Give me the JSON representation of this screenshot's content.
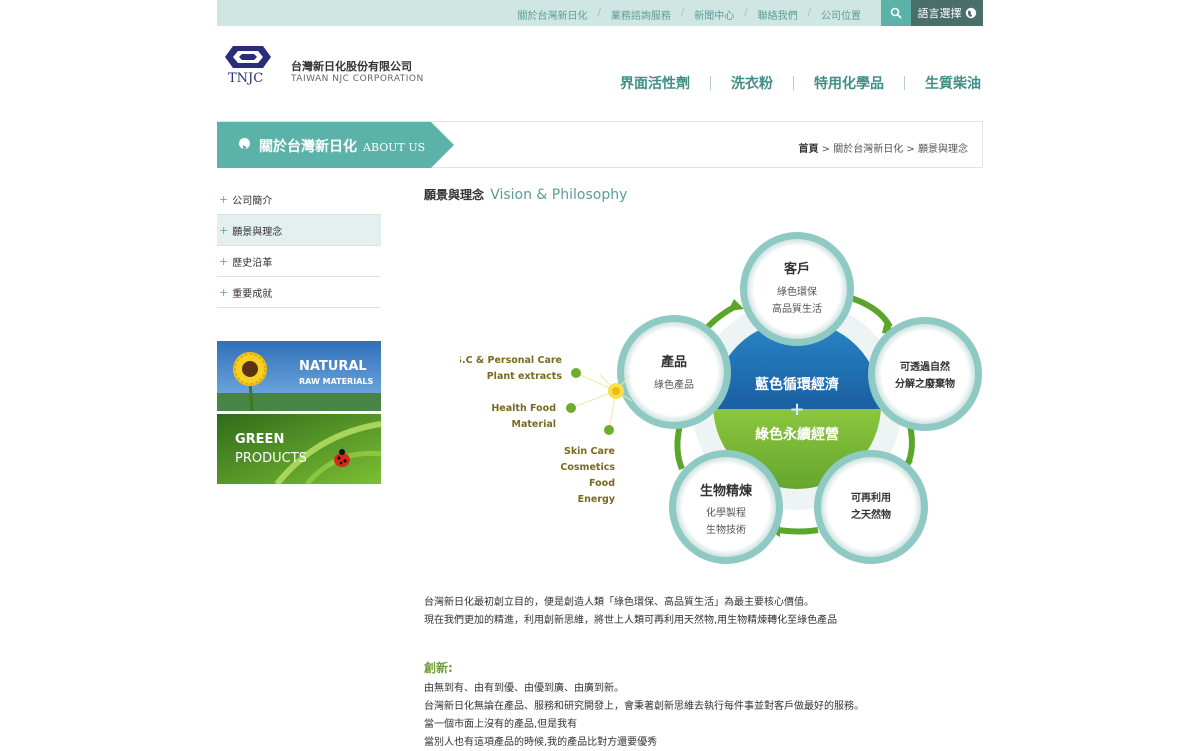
{
  "topbar": {
    "links": [
      "關於台灣新日化",
      "業務諮詢服務",
      "新聞中心",
      "聯絡我們",
      "公司位置"
    ],
    "language_label": "語言選擇"
  },
  "header": {
    "logo_text": "TNJC",
    "company_zh": "台灣新日化股份有限公司",
    "company_en": "TAIWAN NJC CORPORATION"
  },
  "nav": {
    "items": [
      "界面活性劑",
      "洗衣粉",
      "特用化學品",
      "生質柴油"
    ]
  },
  "banner": {
    "title": "關於台灣新日化",
    "title_en": "ABOUT US",
    "breadcrumb": {
      "home": "首頁",
      "level1": "關於台灣新日化",
      "level2": "願景與理念",
      "sep": ">"
    }
  },
  "sidebar": {
    "items": [
      {
        "label": "公司簡介",
        "active": false
      },
      {
        "label": "願景與理念",
        "active": true
      },
      {
        "label": "歷史沿革",
        "active": false
      },
      {
        "label": "重要成就",
        "active": false
      }
    ],
    "promo1": {
      "line1": "NATURAL",
      "line2": "RAW MATERIALS"
    },
    "promo2": {
      "line1": "GREEN",
      "line2": "PRODUCTS"
    }
  },
  "content": {
    "title_zh": "願景與理念",
    "title_en": "Vision & Philosophy",
    "diagram": {
      "center_top": "藍色循環經濟",
      "center_plus": "+",
      "center_bottom": "綠色永續經營",
      "nodes": {
        "customer": {
          "title": "客戶",
          "line1": "綠色環保",
          "line2": "高品質生活"
        },
        "product": {
          "title": "產品",
          "line1": "綠色產品"
        },
        "decompose": {
          "line1": "可透過自然",
          "line2": "分解之廢棄物"
        },
        "reuse": {
          "line1": "可再利用",
          "line2": "之天然物"
        },
        "refine": {
          "title": "生物精煉",
          "line1": "化學製程",
          "line2": "生物技術"
        }
      },
      "side_labels": {
        "group1": [
          "S.C & Personal Care",
          "Plant extracts"
        ],
        "group2": [
          "Health Food",
          "Material"
        ],
        "group3": [
          "Skin Care",
          "Cosmetics",
          "Food",
          "Energy"
        ]
      }
    },
    "intro": [
      "台灣新日化最初創立目的，便是創造人類「綠色環保、高品質生活」為最主要核心價值。",
      "現在我們更加的精進，利用創新思維，將世上人類可再利用天然物,用生物精煉轉化至綠色產品"
    ],
    "innovation_title": "創新:",
    "innovation": [
      "由無到有、由有到優、由優到廣、由廣到新。",
      "台灣新日化無論在產品、服務和研究開發上，會秉著創新思維去執行每件事並對客戶做最好的服務。",
      "當一個市面上沒有的產品,但是我有",
      "當別人也有這項產品的時候,我的產品比對方還要優秀"
    ]
  }
}
